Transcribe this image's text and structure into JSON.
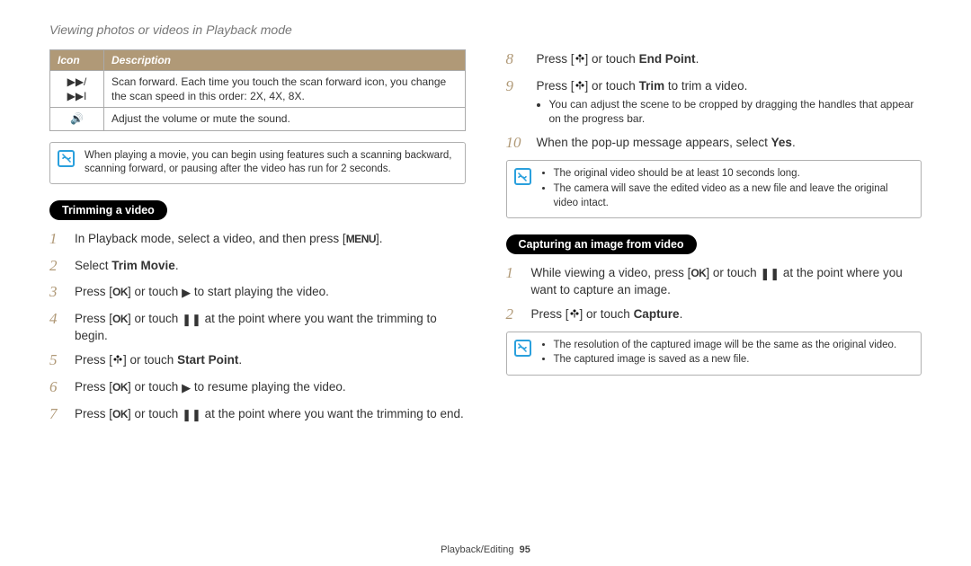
{
  "header": {
    "title": "Viewing photos or videos in Playback mode"
  },
  "table": {
    "headers": {
      "icon": "Icon",
      "desc": "Description"
    },
    "rows": [
      {
        "icon": "▶▶/▶▶I",
        "desc": "Scan forward. Each time you touch the scan forward icon, you change the scan speed in this order: 2X, 4X, 8X."
      },
      {
        "icon": "🔊",
        "desc": "Adjust the volume or mute the sound."
      }
    ]
  },
  "note_playback": "When playing a movie, you can begin using features such a scanning backward, scanning forward, or pausing after the video has run for 2 seconds.",
  "section_trim": {
    "heading": "Trimming a video"
  },
  "steps_left": {
    "s1a": "In Playback mode, select a video, and then press [",
    "s1b": "].",
    "s2a": "Select ",
    "s2b": "Trim Movie",
    "s2c": ".",
    "s3a": "Press [",
    "s3b": "] or touch ",
    "s3c": " to start playing the video.",
    "s4a": "Press [",
    "s4b": "] or touch ",
    "s4c": " at the point where you want the trimming to begin.",
    "s5a": "Press [",
    "s5b": "] or touch ",
    "s5c": "Start Point",
    "s5d": ".",
    "s6a": "Press [",
    "s6b": "] or touch ",
    "s6c": " to resume playing the video.",
    "s7a": "Press [",
    "s7b": "] or touch ",
    "s7c": " at the point where you want the trimming to end."
  },
  "steps_right": {
    "s8a": "Press [",
    "s8b": "] or touch ",
    "s8c": "End Point",
    "s8d": ".",
    "s9a": "Press [",
    "s9b": "] or touch ",
    "s9c": "Trim",
    "s9d": " to trim a video.",
    "s9bullet": "You can adjust the scene to be cropped by dragging the handles that appear on the progress bar.",
    "s10a": "When the pop-up message appears, select ",
    "s10b": "Yes",
    "s10c": "."
  },
  "note_trim": {
    "b1": "The original video should be at least 10 seconds long.",
    "b2": "The camera will save the edited video as a new file and leave the original video intact."
  },
  "section_capture": {
    "heading": "Capturing an image from video"
  },
  "steps_capture": {
    "s1a": "While viewing a video, press [",
    "s1b": "] or touch ",
    "s1c": " at the point where you want to capture an image.",
    "s2a": "Press [",
    "s2b": "] or touch ",
    "s2c": "Capture",
    "s2d": "."
  },
  "note_capture": {
    "b1": "The resolution of the captured image will be the same as the original video.",
    "b2": "The captured image is saved as a new file."
  },
  "labels": {
    "menu": "MENU",
    "ok": "OK"
  },
  "footer": {
    "section": "Playback/Editing",
    "page": "95"
  }
}
